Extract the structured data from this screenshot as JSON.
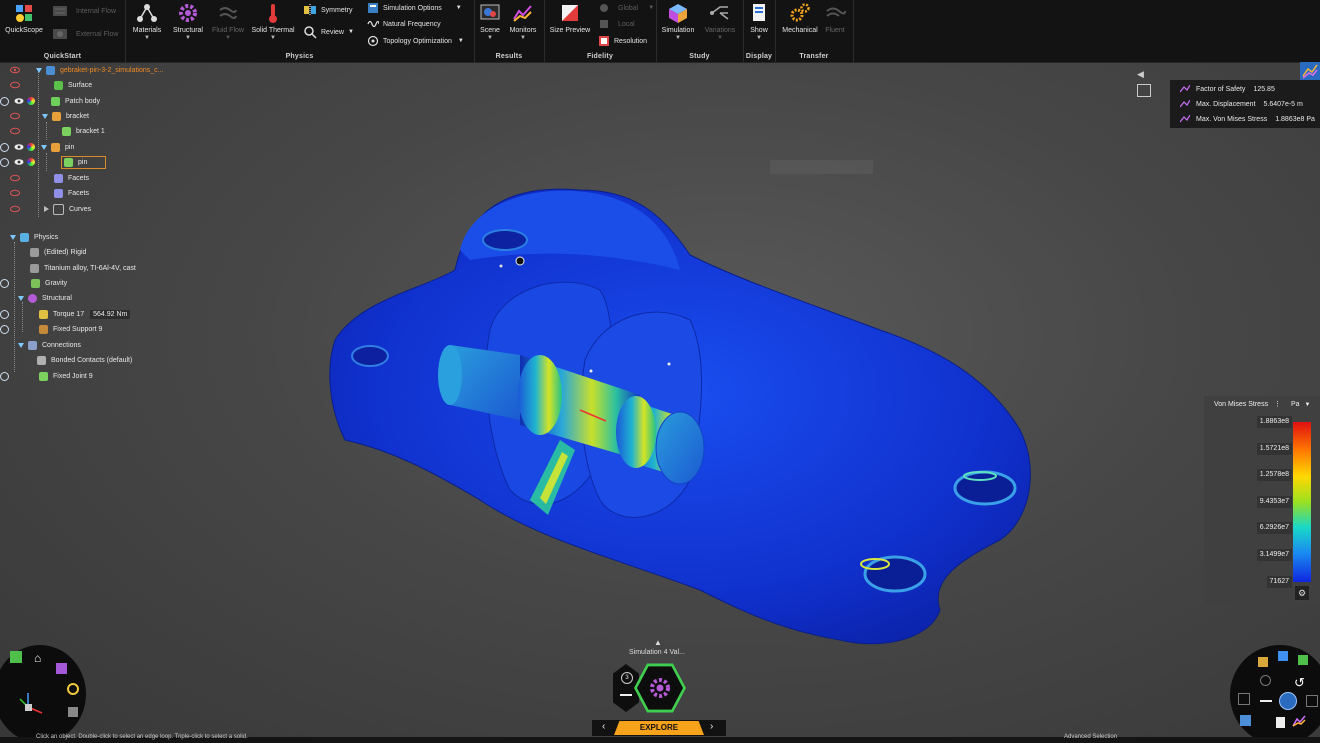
{
  "ribbon": {
    "quickstart": {
      "label": "QuickStart",
      "quickscope": "QuickScope",
      "internal_flow": "Internal Flow",
      "external_flow": "External Flow"
    },
    "physics": {
      "label": "Physics",
      "materials": "Materials",
      "structural": "Structural",
      "fluid_flow": "Fluid Flow",
      "solid_thermal": "Solid Thermal",
      "symmetry": "Symmetry",
      "review": "Review",
      "simulation_options": "Simulation Options",
      "natural_frequency": "Natural Frequency",
      "topology_optimization": "Topology Optimization"
    },
    "results": {
      "label": "Results",
      "scene": "Scene",
      "monitors": "Monitors"
    },
    "fidelity": {
      "label": "Fidelity",
      "size_preview": "Size Preview",
      "global": "Global",
      "local": "Local",
      "resolution": "Resolution"
    },
    "study": {
      "label": "Study",
      "simulation": "Simulation",
      "variations": "Variations"
    },
    "display": {
      "label": "Display",
      "show": "Show"
    },
    "transfer": {
      "label": "Transfer",
      "mechanical": "Mechanical",
      "fluent": "Fluent"
    }
  },
  "tree": {
    "root": "gebraket-pin-3-2_simulations_c...",
    "surface": "Surface",
    "patch_body": "Patch body",
    "bracket": "bracket",
    "bracket1": "bracket 1",
    "pin": "pin",
    "pin_child": "pin",
    "facets1": "Facets",
    "facets2": "Facets",
    "curves": "Curves",
    "physics": "Physics",
    "rigid": "(Edited) Rigid",
    "material": "Titanium alloy, TI-6Al-4V, cast",
    "gravity": "Gravity",
    "structural": "Structural",
    "torque": "Torque 17",
    "torque_value": "564.92 Nm",
    "fixed_support": "Fixed Support 9",
    "connections": "Connections",
    "bonded": "Bonded Contacts (default)",
    "fixed_joint": "Fixed Joint 9"
  },
  "stats": {
    "fos_label": "Factor of Safety",
    "fos_value": "125.85",
    "disp_label": "Max. Displacement",
    "disp_value": "5.6407e-5 m",
    "vm_label": "Max. Von Mises Stress",
    "vm_value": "1.8863e8 Pa"
  },
  "legend": {
    "title": "Von Mises Stress",
    "unit": "Pa",
    "ticks": [
      "1.8863e8",
      "1.5721e8",
      "1.2578e8",
      "9.4353e7",
      "6.2926e7",
      "3.1499e7",
      "71627"
    ]
  },
  "bottom": {
    "simulation_name": "Simulation 4 Val...",
    "mode_label": "Explore",
    "status_left": "Click an object. Double-click to select an edge loop. Triple-click to select a solid.",
    "status_right": "Advanced Selection"
  },
  "colors": {
    "accent": "#f7a21b",
    "root_text": "#f08a24",
    "mesh_blue": "#1236d8"
  }
}
